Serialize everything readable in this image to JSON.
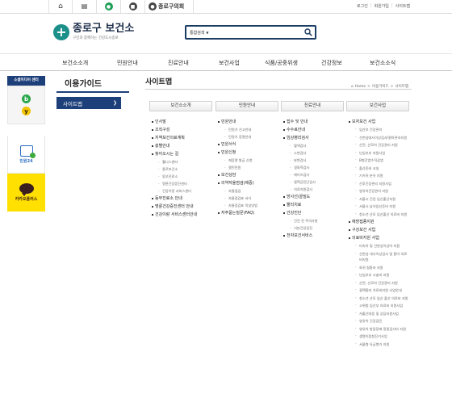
{
  "topbar": {
    "icons": [
      "home-icon",
      "palace-icon",
      "health-icon",
      "district-office-icon"
    ],
    "council_label": "종로구의회",
    "links": [
      "로그인",
      "회원가입",
      "사이트맵"
    ]
  },
  "header": {
    "logo_title": "종로구 보건소",
    "logo_sub": "구민과 함께하는 건강도시종로",
    "search_select": "통합검색",
    "search_placeholder": ""
  },
  "gnb": [
    "보건소소개",
    "민원안내",
    "진료안내",
    "보건사업",
    "식품/공중위생",
    "건강정보",
    "보건소소식"
  ],
  "quick": {
    "head": "소셜미디어 센터",
    "blog_letter": "b",
    "youtube_letter": "y",
    "minwon_label": "민원24",
    "kakao_label": "카카오플러스"
  },
  "lnb": {
    "title": "이용가이드",
    "active": "사이트맵"
  },
  "content": {
    "title": "사이트맵",
    "breadcrumb": [
      "Home",
      "이용가이드",
      "사이트맵"
    ]
  },
  "sitemap": [
    {
      "head": "보건소소개",
      "items": [
        {
          "t": "인사말"
        },
        {
          "t": "조직구성"
        },
        {
          "t": "지역보건의료계획"
        },
        {
          "t": "층별안내"
        },
        {
          "t": "찾아오시는 길",
          "subs": [
            "웰니스센터",
            "종로보건소",
            "동부진료소",
            "명륜건강증진센터",
            "건강이랑 서비스센터"
          ]
        },
        {
          "t": "동부진료소 안내"
        },
        {
          "t": "명륜건강증진센터 안내"
        },
        {
          "t": "건강이랑 서비스센터안내"
        }
      ]
    },
    {
      "head": "민원안내",
      "items": [
        {
          "t": "민원안내",
          "subs": [
            "민원기 신고안내",
            "민원기 증명안내"
          ]
        },
        {
          "t": "민원서식"
        },
        {
          "t": "민원신청",
          "subs": [
            "제증명 발급 신청",
            "열린민원"
          ]
        },
        {
          "t": "보건상담"
        },
        {
          "t": "의약자율점검(제증)",
          "subs": [
            "자율점검",
            "자율점검표 서식",
            "자율점검표 작성방법"
          ]
        },
        {
          "t": "자주묻는질문(FAQ)"
        }
      ]
    },
    {
      "head": "진료안내",
      "items": [
        {
          "t": "접수 및 안내"
        },
        {
          "t": "수수료안내"
        },
        {
          "t": "임상병리검사",
          "subs": [
            "혈액검사",
            "소변검사",
            "분변검사",
            "생화학검사",
            "에이즈검사",
            "결핵균진단검사",
            "의료지원검사"
          ]
        },
        {
          "t": "방사선/골밀도"
        },
        {
          "t": "물리치료"
        },
        {
          "t": "건강진단",
          "subs": [
            "건진 전 주의사항",
            "기본건강검진"
          ]
        },
        {
          "t": "전자보건서비스"
        }
      ]
    },
    {
      "head": "보건사업",
      "items": [
        {
          "t": "모자보건 사업",
          "subs": [
            "임산부 건강관리",
            "선천성대사이상검사/환아관리지원",
            "산전, 산모아 건강관리 지원",
            "난임부부 지원사업",
            "B형간염수직감염",
            "출산준비 교실",
            "기저귀 분유 지원",
            "산후건강관리 지원사업",
            "영유아건강관리 지원",
            "서울시 건강 임신출산지원",
            "서울시 남녀임신준비 지원",
            "청소년 산모 임신출산 의료비 지원"
          ]
        },
        {
          "t": "예방접종지원"
        },
        {
          "t": "구강보건 사업"
        },
        {
          "t": "의료비지원 사업",
          "subs": [
            "미숙아 및 선천성이상아 지원",
            "선천성 대사이상검사 및 환아 의료비지원",
            "회귀 질환자 지원",
            "난임부부 시술비 지원",
            "산전, 산모아 건강관리 지원",
            "결핵환자 치료비지원 사업안내",
            "청소년 산모 임신 출산 의료비 지원",
            "고위험 임산부 의료비 지원사업",
            "저출산대응 및 상담지원사업",
            "영유아 건강검진",
            "영유아 발달장애 정밀검사비 지원",
            "생명이음청진기사업",
            "서울형 유급병가 지원"
          ]
        }
      ]
    }
  ]
}
